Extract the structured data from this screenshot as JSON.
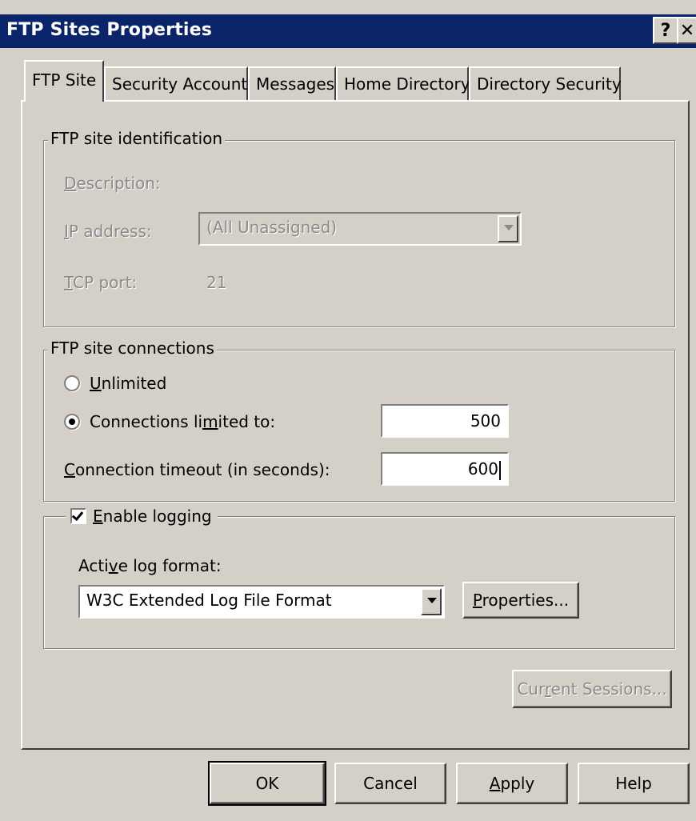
{
  "window": {
    "title": "FTP Sites Properties",
    "help_label": "?",
    "close_label": "✕"
  },
  "tabs": [
    {
      "label": "FTP Site",
      "active": true
    },
    {
      "label": "Security Accounts",
      "active": false
    },
    {
      "label": "Messages",
      "active": false
    },
    {
      "label": "Home Directory",
      "active": false
    },
    {
      "label": "Directory Security",
      "active": false
    }
  ],
  "identification": {
    "legend": "FTP site identification",
    "description_label_access": "D",
    "description_label_rest": "escription:",
    "ip_label_access": "I",
    "ip_label_rest": "P address:",
    "ip_value": "(All Unassigned)",
    "port_label_access": "T",
    "port_label_rest": "CP port:",
    "port_value": "21"
  },
  "connections": {
    "legend": "FTP site connections",
    "unlimited_access": "U",
    "unlimited_rest": "nlimited",
    "unlimited_selected": false,
    "limited_pre": "Connections li",
    "limited_access": "m",
    "limited_post": "ited to:",
    "limited_selected": true,
    "limited_value": "500",
    "timeout_access": "C",
    "timeout_rest": "onnection timeout (in seconds):",
    "timeout_value": "600"
  },
  "logging": {
    "enable_access": "E",
    "enable_rest": "nable logging",
    "enabled": true,
    "format_pre": "Acti",
    "format_access": "v",
    "format_post": "e log format:",
    "format_value": "W3C Extended Log File Format",
    "properties_access": "P",
    "properties_rest": "roperties..."
  },
  "sessions": {
    "pre": "Cur",
    "access": "r",
    "post": "ent Sessions..."
  },
  "buttons": {
    "ok": "OK",
    "cancel": "Cancel",
    "apply_access": "A",
    "apply_rest": "pply",
    "help": "Help"
  }
}
